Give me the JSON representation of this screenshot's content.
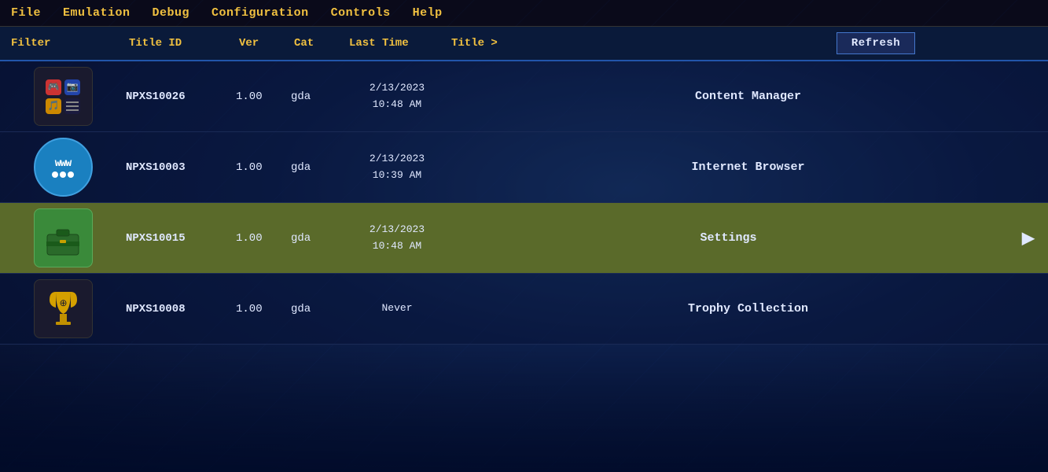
{
  "menubar": {
    "items": [
      {
        "id": "file",
        "label": "File"
      },
      {
        "id": "emulation",
        "label": "Emulation"
      },
      {
        "id": "debug",
        "label": "Debug"
      },
      {
        "id": "configuration",
        "label": "Configuration"
      },
      {
        "id": "controls",
        "label": "Controls"
      },
      {
        "id": "help",
        "label": "Help"
      }
    ]
  },
  "table": {
    "headers": {
      "filter": "Filter",
      "titleid": "Title ID",
      "ver": "Ver",
      "cat": "Cat",
      "lasttime": "Last Time",
      "title": "Title >",
      "refresh": "Refresh"
    },
    "rows": [
      {
        "id": "row-1",
        "titleid": "NPXS10026",
        "ver": "1.00",
        "cat": "gda",
        "lasttime_line1": "2/13/2023",
        "lasttime_line2": "10:48 AM",
        "title": "Content Manager",
        "selected": false,
        "icon_type": "content_manager"
      },
      {
        "id": "row-2",
        "titleid": "NPXS10003",
        "ver": "1.00",
        "cat": "gda",
        "lasttime_line1": "2/13/2023",
        "lasttime_line2": "10:39 AM",
        "title": "Internet Browser",
        "selected": false,
        "icon_type": "browser"
      },
      {
        "id": "row-3",
        "titleid": "NPXS10015",
        "ver": "1.00",
        "cat": "gda",
        "lasttime_line1": "2/13/2023",
        "lasttime_line2": "10:48 AM",
        "title": "Settings",
        "selected": true,
        "icon_type": "settings"
      },
      {
        "id": "row-4",
        "titleid": "NPXS10008",
        "ver": "1.00",
        "cat": "gda",
        "lasttime_line1": "Never",
        "lasttime_line2": "",
        "title": "Trophy Collection",
        "selected": false,
        "icon_type": "trophy"
      }
    ]
  },
  "colors": {
    "menu_text": "#f0c040",
    "header_bg": "#0a1a3a",
    "selected_row": "#5a6a2a",
    "normal_row": "rgba(5,15,50,0.4)"
  }
}
